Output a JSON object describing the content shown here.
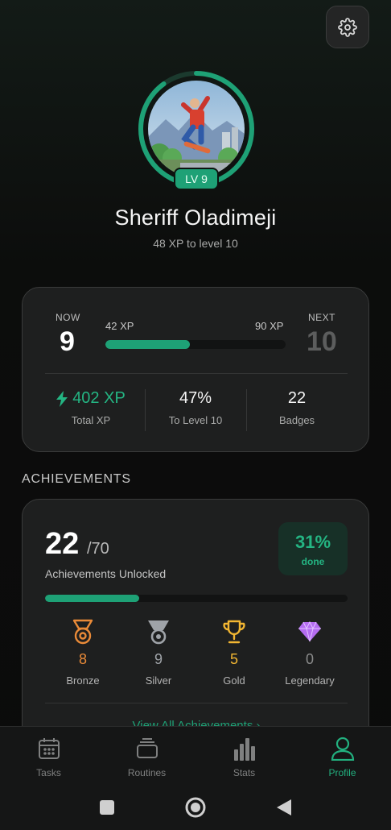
{
  "colors": {
    "accent": "#1ea176",
    "accent_bright": "#24b583",
    "bronze": "#e98a38",
    "silver": "#9fa3a8",
    "gold": "#f2b632",
    "legendary": "#b46cf0",
    "background": "#0f100f",
    "card": "#1e1f1f"
  },
  "header": {
    "settings_icon": "gear-icon"
  },
  "profile": {
    "avatar_icon": "avatar-skateboarder-image",
    "level_badge": "LV 9",
    "level_progress": 0.9,
    "name": "Sheriff Oladimeji",
    "subtitle": "48 XP to level 10"
  },
  "level_card": {
    "now_label": "NOW",
    "now_value": "9",
    "next_label": "NEXT",
    "next_value": "10",
    "xp_start": "42 XP",
    "xp_end": "90 XP",
    "progress_fraction": 0.47,
    "stats": [
      {
        "icon": "lightning-bolt-icon",
        "value": "402 XP",
        "label": "Total XP"
      },
      {
        "value": "47%",
        "label": "To Level 10"
      },
      {
        "value": "22",
        "label": "Badges"
      }
    ]
  },
  "achievements": {
    "section_title": "ACHIEVEMENTS",
    "unlocked": "22",
    "total": "/70",
    "subtitle": "Achievements Unlocked",
    "percent": "31%",
    "percent_label": "done",
    "progress_fraction": 0.31,
    "tiers": [
      {
        "icon": "bronze-medal-icon",
        "value": "8",
        "label": "Bronze",
        "color": "#e98a38"
      },
      {
        "icon": "silver-medal-icon",
        "value": "9",
        "label": "Silver",
        "color": "#9fa3a8"
      },
      {
        "icon": "gold-trophy-icon",
        "value": "5",
        "label": "Gold",
        "color": "#f2b632"
      },
      {
        "icon": "diamond-icon",
        "value": "0",
        "label": "Legendary",
        "color": "#8a8b8b"
      }
    ],
    "view_all": "View All Achievements ›"
  },
  "bottom_nav": {
    "items": [
      {
        "icon": "calendar-icon",
        "label": "Tasks"
      },
      {
        "icon": "stack-icon",
        "label": "Routines"
      },
      {
        "icon": "bar-chart-icon",
        "label": "Stats"
      },
      {
        "icon": "user-icon",
        "label": "Profile",
        "active": true
      }
    ]
  },
  "system_nav": {
    "recents_icon": "square-icon",
    "home_icon": "circle-icon",
    "back_icon": "triangle-back-icon"
  }
}
